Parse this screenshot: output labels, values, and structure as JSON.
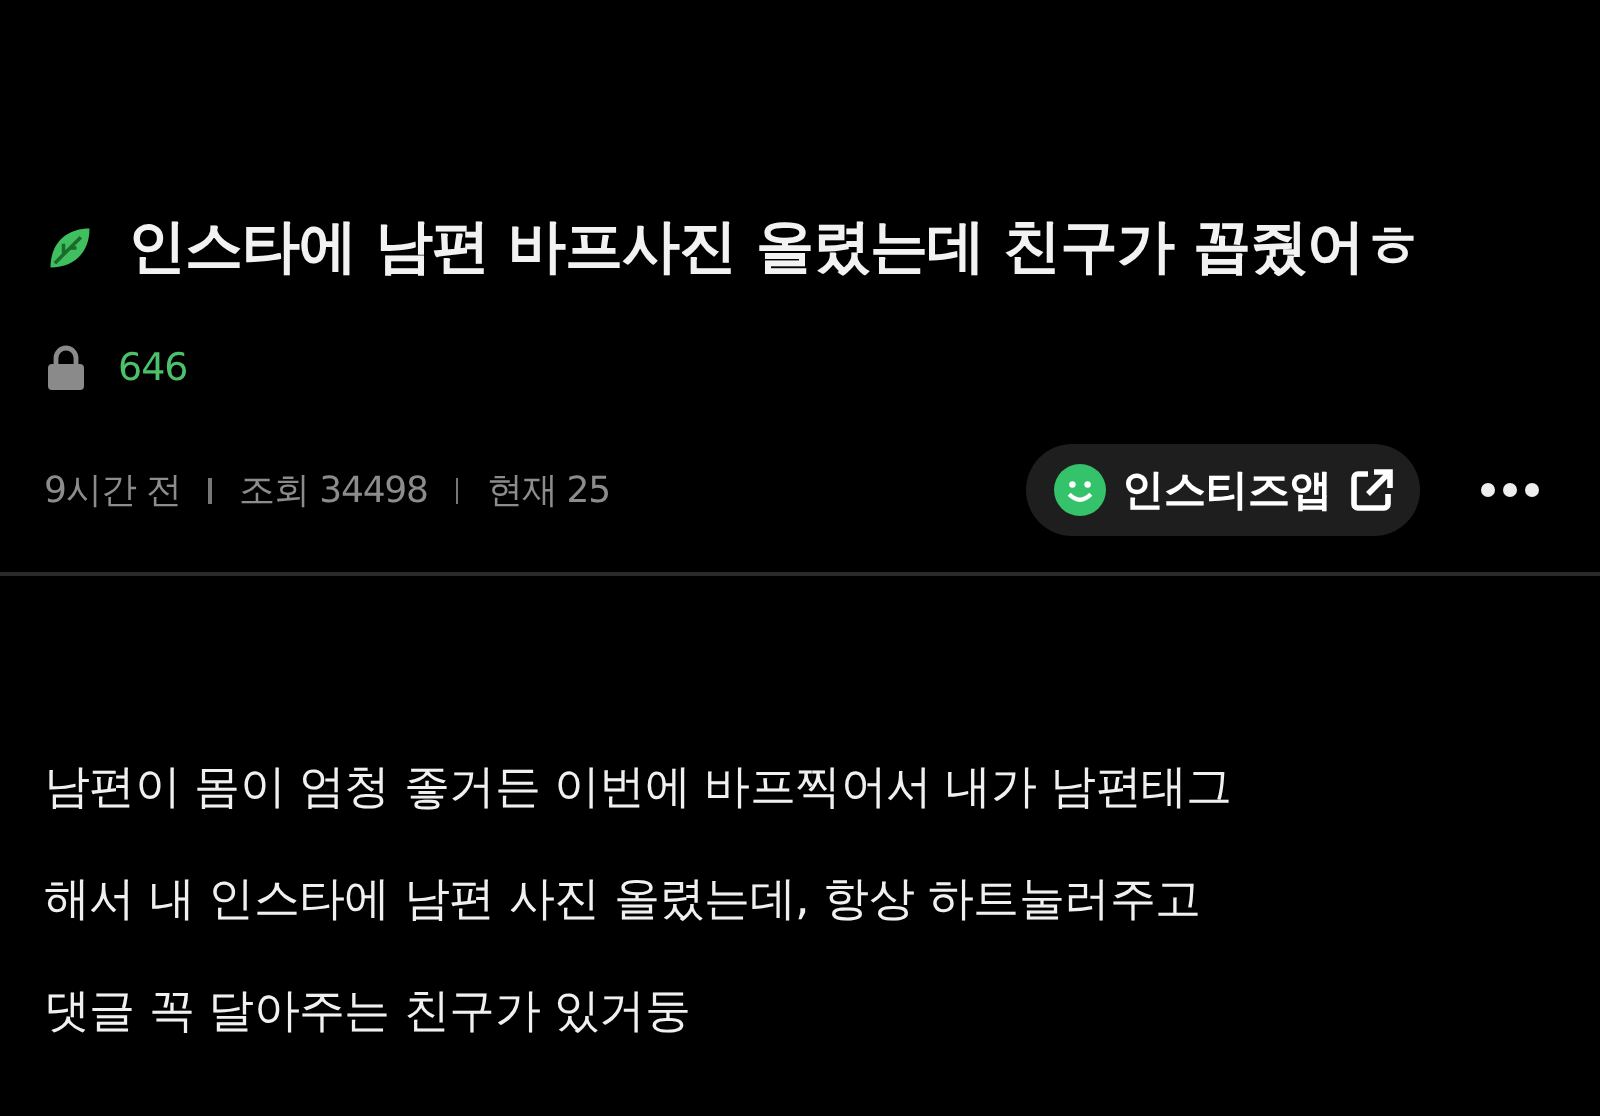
{
  "post": {
    "title": "인스타에 남편 바프사진 올렸는데 친구가 꼽줬어ㅎ",
    "locked_count": "646",
    "meta": [
      "9시간 전",
      "조회 34498",
      "현재 25"
    ],
    "app_button": "인스티즈앱",
    "body_lines": [
      "남편이 몸이 엄청 좋거든 이번에 바프찍어서 내가 남편태그",
      "해서 내 인스타에 남편 사진 올렸는데, 항상 하트눌러주고",
      "댓글 꼭 달아주는 친구가 있거둥"
    ]
  }
}
